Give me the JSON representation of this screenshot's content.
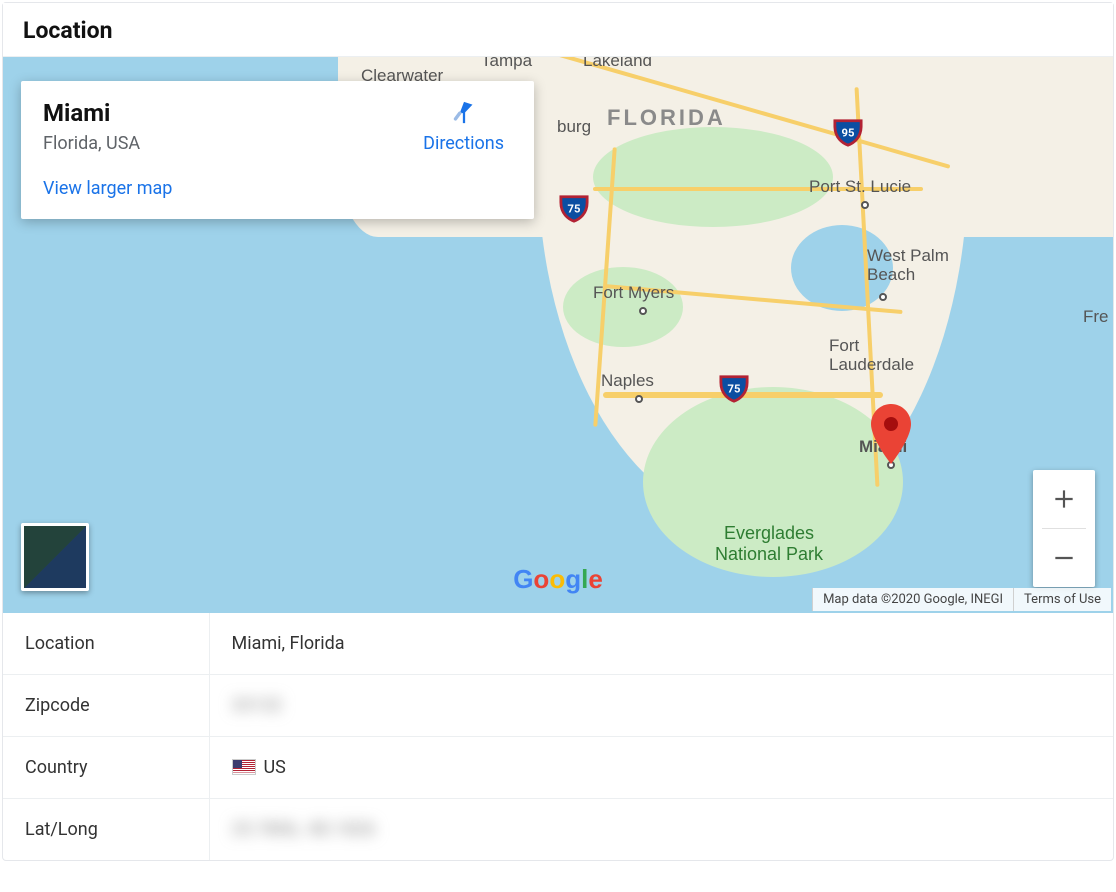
{
  "header": {
    "title": "Location"
  },
  "info_card": {
    "place": "Miami",
    "region": "Florida, USA",
    "directions_label": "Directions",
    "view_larger_label": "View larger map"
  },
  "map": {
    "state_label": "FLORIDA",
    "cities": {
      "tampa": "Tampa",
      "clearwater": "Clearwater",
      "lakeland": "Lakeland",
      "stpetersburg": "St. Petersburg",
      "port_st_lucie": "Port St. Lucie",
      "west_palm_beach": "West Palm Beach",
      "fort_lauderdale": "Fort Lauderdale",
      "miami": "Miami",
      "naples": "Naples",
      "fort_myers": "Fort Myers",
      "fremont_cut": "Fre"
    },
    "burg_fragment": "burg",
    "everglades": "Everglades\nNational Park",
    "shields": {
      "i95": "95",
      "i75a": "75",
      "i75b": "75"
    },
    "attribution": "Map data ©2020 Google, INEGI",
    "terms": "Terms of Use",
    "google": {
      "g1": "G",
      "o1": "o",
      "o2": "o",
      "g2": "g",
      "l": "l",
      "e": "e"
    }
  },
  "controls": {
    "zoom_in_label": "Zoom in",
    "zoom_out_label": "Zoom out",
    "terrain_label": "Toggle satellite"
  },
  "details": {
    "rows": [
      {
        "key": "Location",
        "value": "Miami, Florida",
        "blurred": false,
        "flag": false
      },
      {
        "key": "Zipcode",
        "value": "33132",
        "blurred": true,
        "flag": false
      },
      {
        "key": "Country",
        "value": "US",
        "blurred": false,
        "flag": true
      },
      {
        "key": "Lat/Long",
        "value": "25.7806, -80.1826",
        "blurred": true,
        "flag": false
      }
    ]
  },
  "colors": {
    "link": "#1a73e8",
    "marker": "#ea4335"
  }
}
